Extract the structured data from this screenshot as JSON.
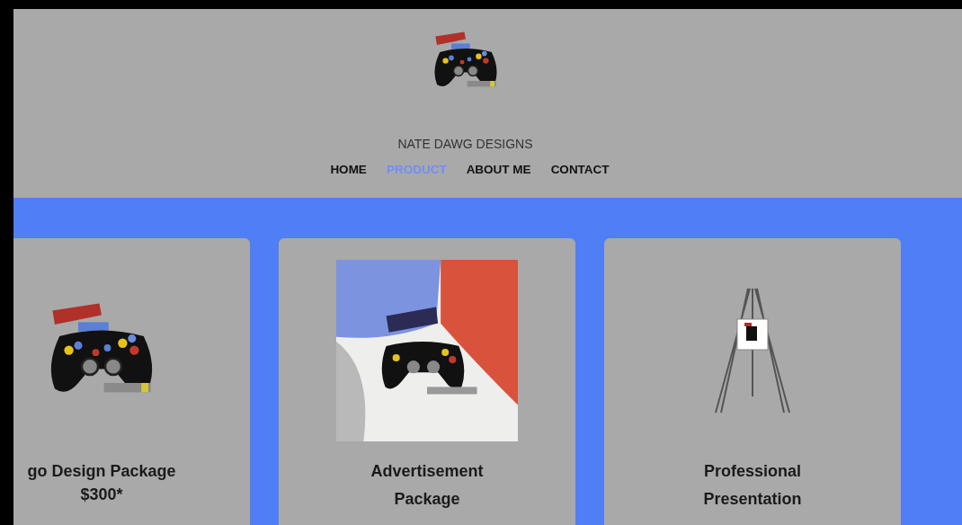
{
  "site_title": "NATE DAWG DESIGNS",
  "nav": [
    {
      "label": "HOME",
      "selected": false
    },
    {
      "label": "PRODUCT",
      "selected": true
    },
    {
      "label": "ABOUT ME",
      "selected": false
    },
    {
      "label": "CONTACT",
      "selected": false
    }
  ],
  "products": [
    {
      "kind": "logo",
      "title": "go Design Package",
      "price": "$300*"
    },
    {
      "kind": "advertisement",
      "title": "Advertisement Package"
    },
    {
      "kind": "presentation",
      "title": "Professional Presentation"
    }
  ]
}
